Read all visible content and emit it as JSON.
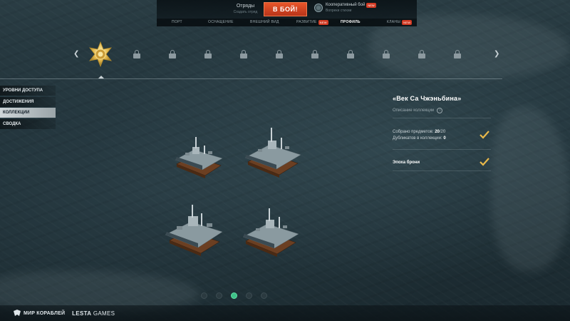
{
  "topbar": {
    "squad": {
      "label": "Отряды",
      "sublabel": "Создать отряд"
    },
    "battle_button": "В БОЙ!",
    "mode": {
      "label": "Кооперативный бой",
      "sublabel": "Вопреки стихии",
      "badge": "NEW"
    }
  },
  "nav": {
    "items": [
      {
        "label": "ПОРТ",
        "badge": ""
      },
      {
        "label": "ОСНАЩЕНИЕ",
        "badge": ""
      },
      {
        "label": "ВНЕШНИЙ ВИД",
        "badge": ""
      },
      {
        "label": "РАЗВИТИЕ",
        "badge": "NEW"
      },
      {
        "label": "ПРОФИЛЬ",
        "badge": ""
      },
      {
        "label": "КЛАНЫ",
        "badge": "NEW"
      }
    ],
    "active": "ПРОФИЛЬ"
  },
  "ribbon": {
    "selected_medal_icon": "golden-star-medal-icon",
    "locked_icon": "lock-icon"
  },
  "sidebar": {
    "items": [
      {
        "label": "УРОВНИ ДОСТУПА"
      },
      {
        "label": "ДОСТИЖЕНИЯ"
      },
      {
        "label": "КОЛЛЕКЦИИ"
      },
      {
        "label": "СВОДКА"
      }
    ],
    "active": "КОЛЛЕКЦИИ"
  },
  "collection": {
    "title": "«Век Са Чжэньбина»",
    "description_label": "Описание коллекции",
    "collected_label": "Собрано предметов:",
    "collected_value": "20",
    "collected_total": "/20",
    "duplicates_label": "Дубликатов в коллекции:",
    "duplicates_value": "0",
    "era_label": "Эпоха брони"
  },
  "pager": {
    "count": 5,
    "active_index": 2
  },
  "footer": {
    "brand_left": "МИР КОРАБЛЕЙ",
    "brand_right_bold": "LESTA",
    "brand_right_rest": " GAMES"
  },
  "colors": {
    "accent_orange": "#d9451f",
    "check_gold": "#e8b84a",
    "pager_active": "#3fc188",
    "new_badge": "#d23a23"
  }
}
